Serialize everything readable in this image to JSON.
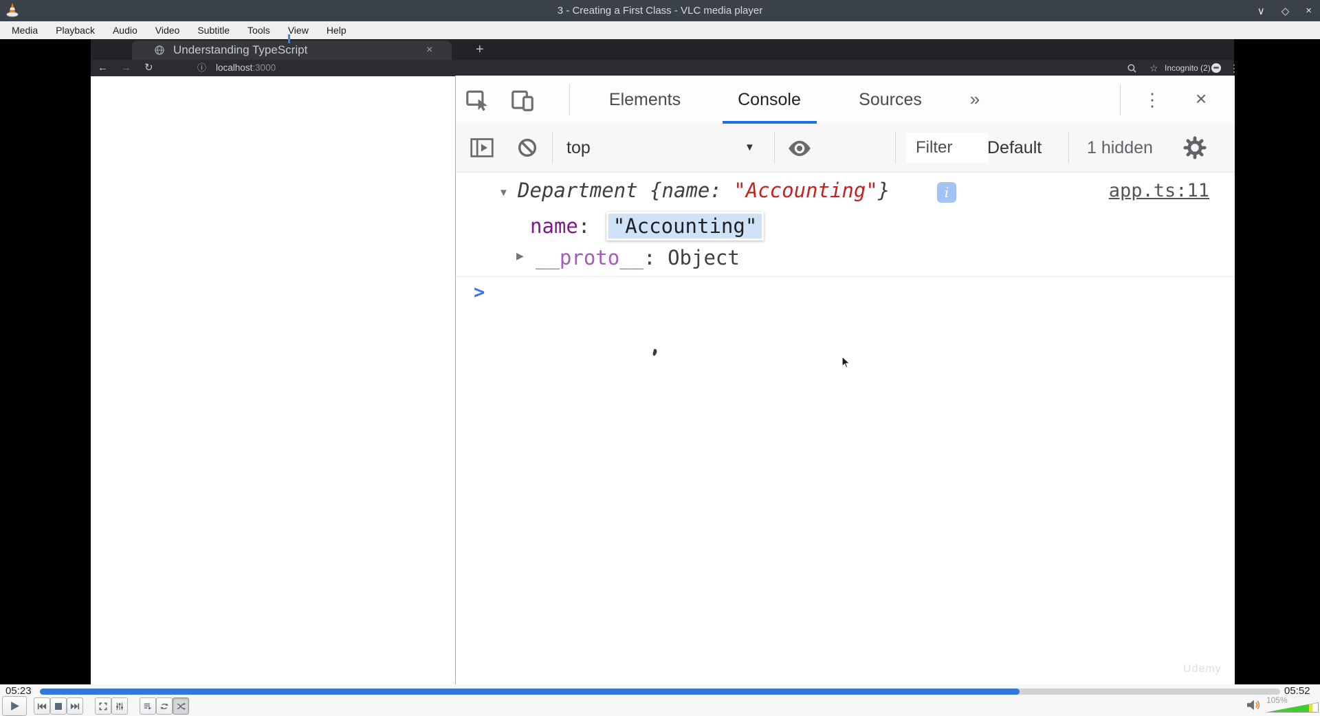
{
  "vlc": {
    "window_title": "3 - Creating a First Class - VLC media player",
    "menu": [
      "Media",
      "Playback",
      "Audio",
      "Video",
      "Subtitle",
      "Tools",
      "View",
      "Help"
    ],
    "elapsed": "05:23",
    "duration": "05:52",
    "seek_percent": 79,
    "volume_label": "105%"
  },
  "icons": {
    "minimize": "∨",
    "maximize": "◇",
    "close": "×",
    "tab_close": "×",
    "new_tab": "+",
    "back": "←",
    "forward": "→",
    "reload": "↻",
    "page_info": "ⓘ",
    "star": "☆",
    "browser_menu": "⋮",
    "more_tabs": "»",
    "devtools_menu": "⋮",
    "devtools_close": "×",
    "context_caret": "▼",
    "expand_open": "▼",
    "expand_closed": "▶",
    "prompt": ">"
  },
  "browser": {
    "tab_title": "Understanding TypeScript",
    "url_host": "localhost",
    "url_port": ":3000",
    "incognito_label": "Incognito (2)"
  },
  "devtools": {
    "tab_elements": "Elements",
    "tab_console": "Console",
    "tab_sources": "Sources",
    "context": "top",
    "filter_placeholder": "Filter",
    "level": "Default",
    "hidden": "1 hidden",
    "log": {
      "class_name": "Department",
      "preview_mid": " {name: ",
      "preview_string": "\"Accounting\"",
      "preview_close": "}",
      "info_badge": "i",
      "source": "app.ts:11",
      "key": "name",
      "colon": ": ",
      "value": "\"Accounting\"",
      "proto_key": "__proto__",
      "proto_sep": ": ",
      "proto_value": "Object"
    }
  },
  "watermark": "Udemy"
}
